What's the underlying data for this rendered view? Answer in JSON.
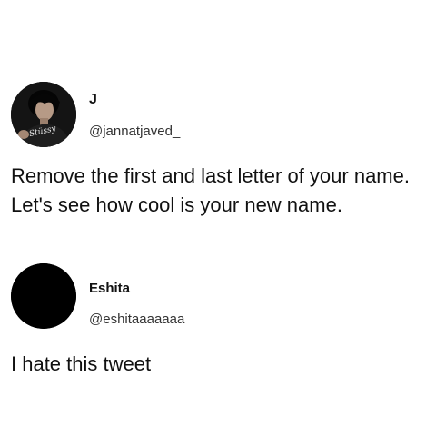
{
  "tweets": [
    {
      "display_name": "J",
      "handle": "@jannatjaved_",
      "text": "Remove the first and last letter of your name. Let's see how cool is your new name.",
      "avatar_overlay_text": "Stüssy"
    },
    {
      "display_name": "Eshita",
      "handle": "@eshitaaaaaaa",
      "text": "I hate this tweet"
    }
  ],
  "icons": {
    "avatar_1": "person-photo-avatar",
    "avatar_2": "black-circle-avatar"
  },
  "colors": {
    "background": "#ffffff",
    "text": "#111111",
    "handle": "#333333",
    "avatar_fill": "#000000"
  }
}
